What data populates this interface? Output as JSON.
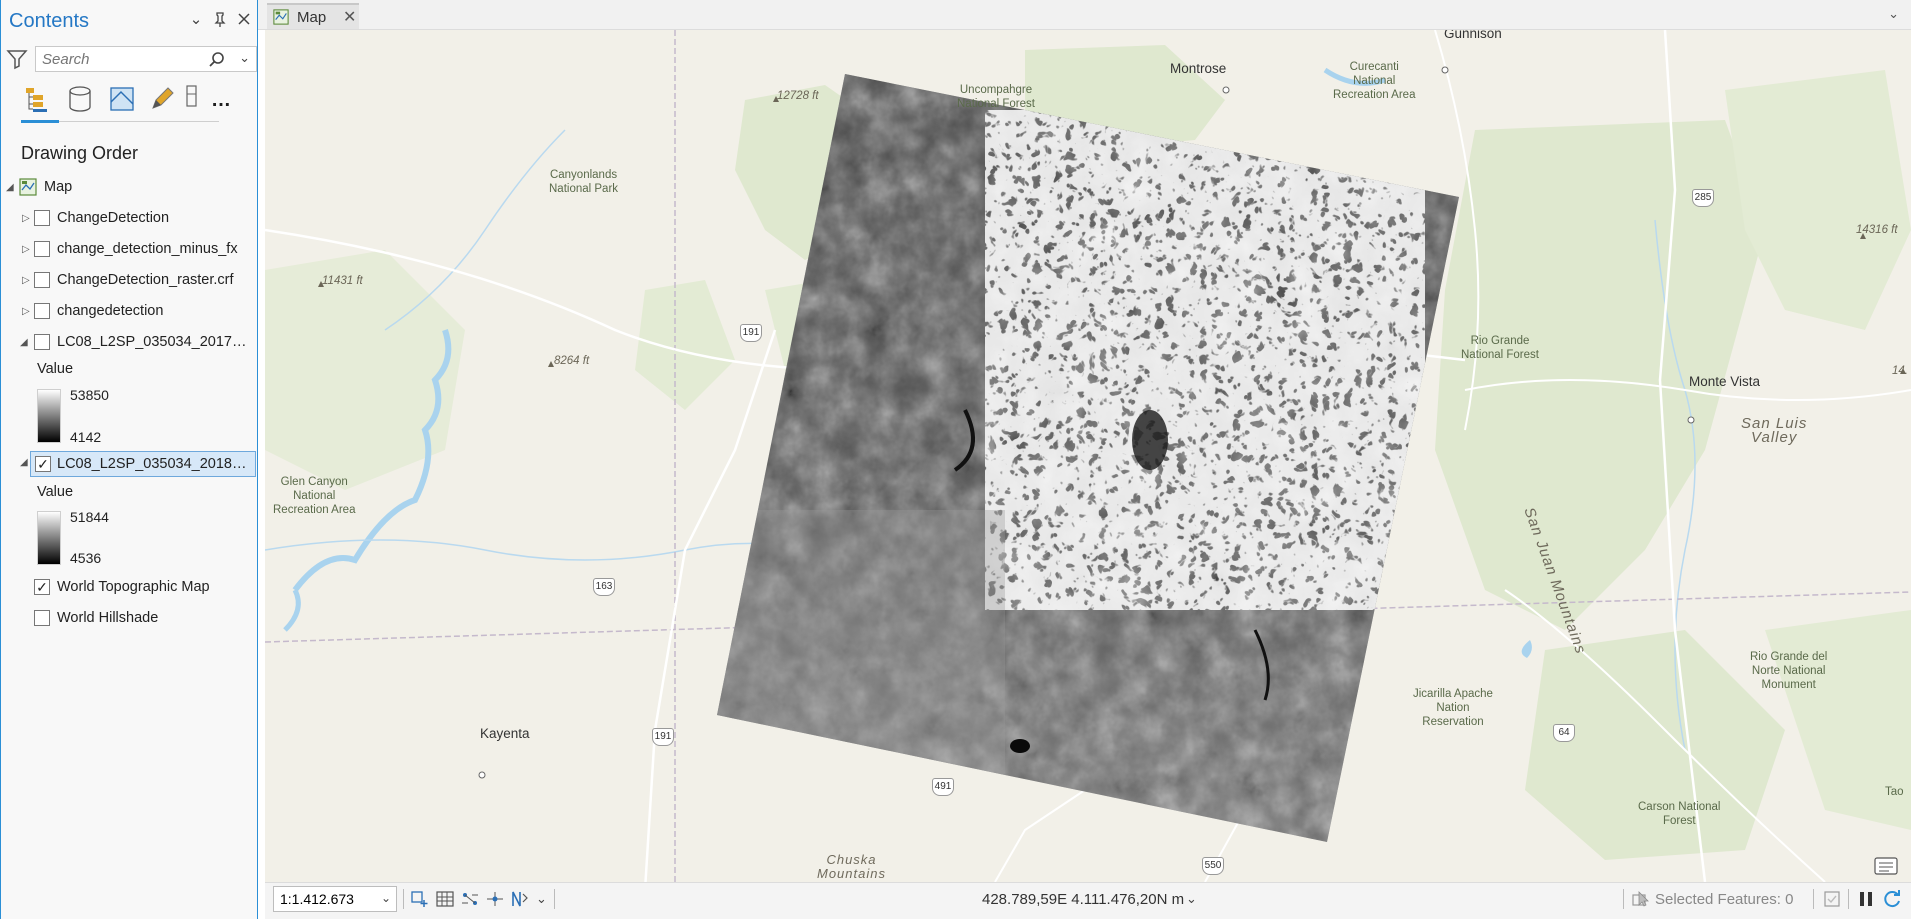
{
  "contents": {
    "title": "Contents",
    "search_placeholder": "Search",
    "section_title": "Drawing Order",
    "map_node": "Map",
    "layers": [
      {
        "label": "ChangeDetection",
        "checked": false
      },
      {
        "label": "change_detection_minus_fx",
        "checked": false
      },
      {
        "label": "ChangeDetection_raster.crf",
        "checked": false
      },
      {
        "label": "changedetection",
        "checked": false
      },
      {
        "label": "LC08_L2SP_035034_201706...",
        "checked": false
      },
      {
        "label": "LC08_L2SP_035034_201806...",
        "checked": true
      },
      {
        "label": "World Topographic Map",
        "checked": true
      },
      {
        "label": "World Hillshade",
        "checked": false
      }
    ],
    "legend1": {
      "title": "Value",
      "high": "53850",
      "low": "4142"
    },
    "legend2": {
      "title": "Value",
      "high": "51844",
      "low": "4536"
    },
    "check_mark": "✓"
  },
  "map_tab": {
    "label": "Map",
    "close": "✕"
  },
  "map_labels": {
    "gunnison": "Gunnison",
    "montrose": "Montrose",
    "curecanti": "Curecanti\nNational\nRecreation Area",
    "uncompahgre": "Uncompahgre\nNational Forest",
    "canyonlands": "Canyonlands\nNational Park",
    "elev_12728": "12728 ft",
    "elev_11431": "11431 ft",
    "elev_8264": "8264 ft",
    "elev_14316": "14316 ft",
    "elev_14": "14.",
    "rio_grande_nf": "Rio Grande\nNational Forest",
    "monte_vista": "Monte Vista",
    "san_luis_valley": "San Luis\nValley",
    "san_juan_mountains": "San Juan Mountains",
    "glen_canyon": "Glen Canyon\nNational\nRecreation Area",
    "kayenta": "Kayenta",
    "jicarilla": "Jicarilla Apache\nNation\nReservation",
    "rio_grande_del_norte": "Rio Grande del\nNorte National\nMonument",
    "carson_nf": "Carson National\nForest",
    "chuska": "Chuska\nMountains",
    "tao": "Tao",
    "route_285": "285",
    "route_191a": "191",
    "route_191b": "191",
    "route_163": "163",
    "route_491": "491",
    "route_64": "64",
    "route_550": "550"
  },
  "status": {
    "scale": "1:1.412.673",
    "coordinates": "428.789,59E 4.111.476,20N m",
    "selected_features": "Selected Features: 0"
  },
  "colors": {
    "accent": "#2b8fd6",
    "map_bg": "#f2f0e8",
    "forest": "#dfe8cf",
    "water": "#a9d3ee"
  }
}
